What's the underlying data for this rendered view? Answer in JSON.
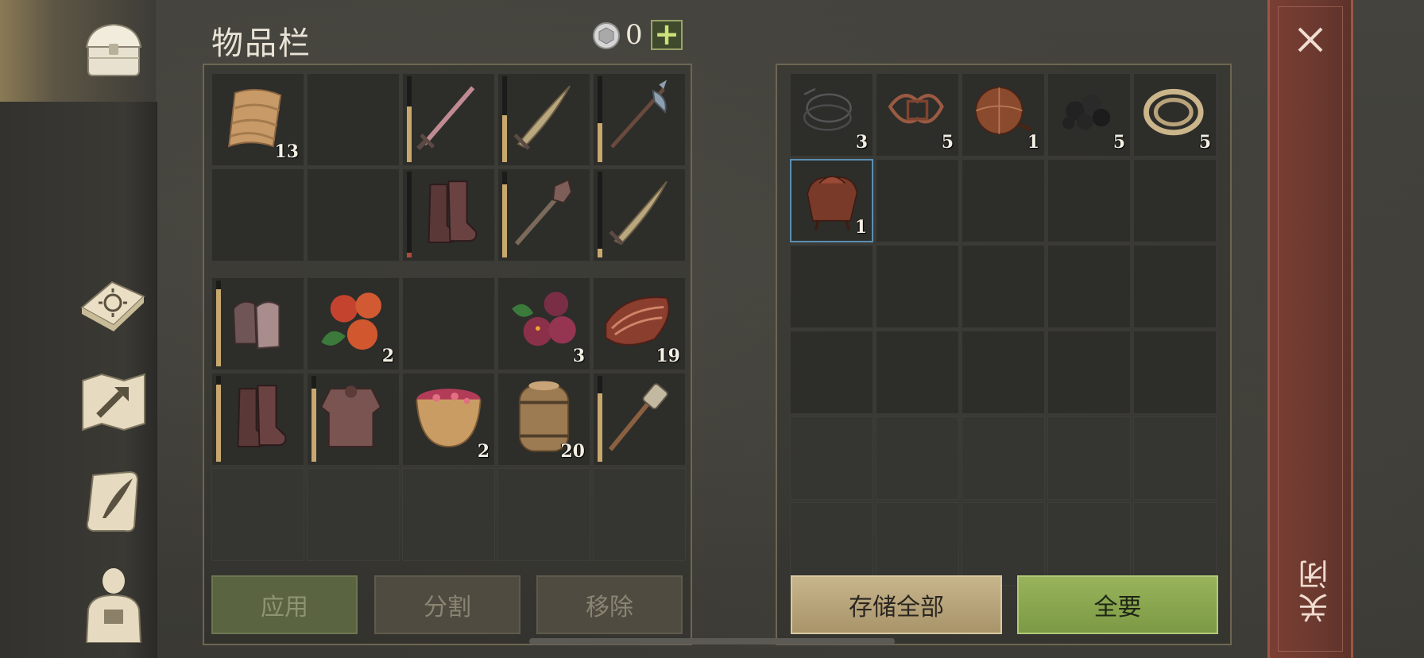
{
  "title": "物品栏",
  "currency": {
    "value": "0",
    "plus_label": "+"
  },
  "nav": [
    {
      "name": "chest-icon",
      "active": true
    },
    {
      "name": "sun-book-icon",
      "active": false
    },
    {
      "name": "map-arrow-icon",
      "active": false
    },
    {
      "name": "quill-scroll-icon",
      "active": false
    },
    {
      "name": "character-icon",
      "active": false
    }
  ],
  "inventory": {
    "equipment": [
      {
        "icon": "cloth-icon",
        "qty": "13"
      },
      {
        "icon": "",
        "qty": ""
      },
      {
        "icon": "sword-icon",
        "qty": "",
        "durability": 0.65
      },
      {
        "icon": "saber-icon",
        "qty": "",
        "durability": 0.55
      },
      {
        "icon": "halberd-icon",
        "qty": "",
        "durability": 0.45
      },
      {
        "icon": "",
        "qty": ""
      },
      {
        "icon": "",
        "qty": ""
      },
      {
        "icon": "boots-icon",
        "qty": "",
        "durability": 0.06,
        "low": true
      },
      {
        "icon": "mace-icon",
        "qty": "",
        "durability": 0.85
      },
      {
        "icon": "short-sword-icon",
        "qty": "",
        "durability": 0.1
      }
    ],
    "backpack": [
      {
        "icon": "mail-gloves-icon",
        "qty": "",
        "durability": 0.9
      },
      {
        "icon": "orange-berries-icon",
        "qty": "2"
      },
      {
        "icon": "",
        "qty": ""
      },
      {
        "icon": "red-berries-icon",
        "qty": "3"
      },
      {
        "icon": "meat-icon",
        "qty": "19"
      },
      {
        "icon": "boots-icon",
        "qty": "",
        "durability": 0.9
      },
      {
        "icon": "chainmail-icon",
        "qty": "",
        "durability": 0.85
      },
      {
        "icon": "berry-bowl-icon",
        "qty": "2"
      },
      {
        "icon": "barrel-icon",
        "qty": "20"
      },
      {
        "icon": "torch-icon",
        "qty": "",
        "durability": 0.8
      },
      {
        "icon": "",
        "qty": ""
      },
      {
        "icon": "",
        "qty": ""
      },
      {
        "icon": "",
        "qty": ""
      },
      {
        "icon": "",
        "qty": ""
      },
      {
        "icon": "",
        "qty": ""
      }
    ]
  },
  "storage": {
    "slots": [
      {
        "icon": "wire-coil-icon",
        "qty": "3"
      },
      {
        "icon": "leather-straps-icon",
        "qty": "5"
      },
      {
        "icon": "leather-flask-icon",
        "qty": "1"
      },
      {
        "icon": "coal-icon",
        "qty": "5"
      },
      {
        "icon": "rope-icon",
        "qty": "5"
      },
      {
        "icon": "saddle-icon",
        "qty": "1",
        "selected": true
      }
    ]
  },
  "buttons": {
    "apply": "应用",
    "split": "分割",
    "remove": "移除",
    "store_all": "存储全部",
    "take_all": "全要",
    "close": "关闭"
  },
  "colors": {
    "accent_green": "#98b35a",
    "accent_tan": "#c7b58c",
    "close_red": "#7a3e33",
    "durability": "#c9a86e",
    "selected_border": "#5a8fb2"
  }
}
